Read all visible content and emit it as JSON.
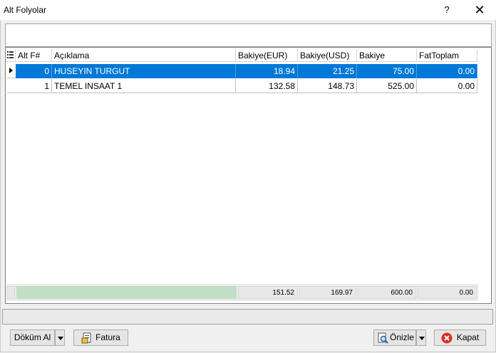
{
  "window": {
    "title": "Alt Folyolar",
    "help_glyph": "?",
    "close_glyph": "✕"
  },
  "grid": {
    "columns": [
      "Alt F#",
      "Açıklama",
      "Bakiye(EUR)",
      "Bakiye(USD)",
      "Bakiye",
      "FatToplam"
    ],
    "rows": [
      {
        "alt_f": "0",
        "aciklama": "HUSEYIN TURGUT",
        "bakiye_eur": "18.94",
        "bakiye_usd": "21.25",
        "bakiye": "75.00",
        "fattoplam": "0.00",
        "selected": true
      },
      {
        "alt_f": "1",
        "aciklama": "TEMEL INSAAT 1",
        "bakiye_eur": "132.58",
        "bakiye_usd": "148.73",
        "bakiye": "525.00",
        "fattoplam": "0.00",
        "selected": false
      }
    ],
    "totals": {
      "bakiye_eur": "151.52",
      "bakiye_usd": "169.97",
      "bakiye": "600.00",
      "fattoplam": "0.00"
    }
  },
  "buttons": {
    "dokum_al": "Döküm Al",
    "fatura": "Fatura",
    "onizle": "Önizle",
    "kapat": "Kapat"
  },
  "colors": {
    "selection": "#0078d7",
    "totals_bar": "#c2dfc6",
    "kapat_icon": "#d93025"
  }
}
